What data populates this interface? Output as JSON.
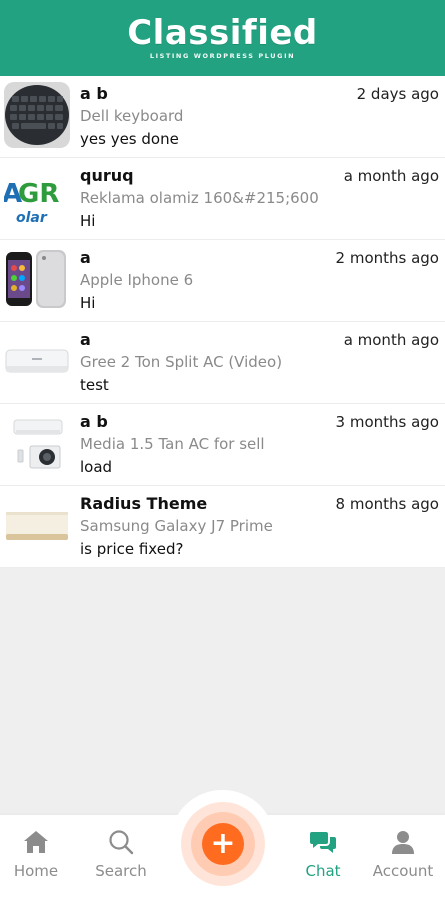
{
  "header": {
    "title": "Classified",
    "subtitle": "LISTING WORDPRESS PLUGIN"
  },
  "chats": [
    {
      "name": "a b",
      "time": "2 days ago",
      "listing": "Dell keyboard",
      "message": "yes yes done",
      "thumb": "keyboard-image"
    },
    {
      "name": "quruq",
      "time": "a month ago",
      "listing": "Reklama olamiz 160&#215;600",
      "message": "Hi",
      "thumb": "agro-logo-image"
    },
    {
      "name": "a",
      "time": "2 months ago",
      "listing": "Apple Iphone 6",
      "message": "Hi",
      "thumb": "iphone-image"
    },
    {
      "name": "a",
      "time": "a month ago",
      "listing": "Gree 2 Ton Split AC (Video)",
      "message": "test",
      "thumb": "ac-unit-image"
    },
    {
      "name": "a b",
      "time": "3 months ago",
      "listing": "Media 1.5 Tan AC for sell",
      "message": "load",
      "thumb": "ac-set-image"
    },
    {
      "name": "Radius Theme",
      "time": "8 months ago",
      "listing": "Samsung Galaxy J7 Prime",
      "message": "is price fixed?",
      "thumb": "phone-box-image"
    }
  ],
  "nav": {
    "home": "Home",
    "search": "Search",
    "add": "+",
    "chat": "Chat",
    "account": "Account"
  },
  "colors": {
    "brand": "#22a281",
    "fab": "#ff6b1f",
    "inactive": "#8c8c8c"
  }
}
